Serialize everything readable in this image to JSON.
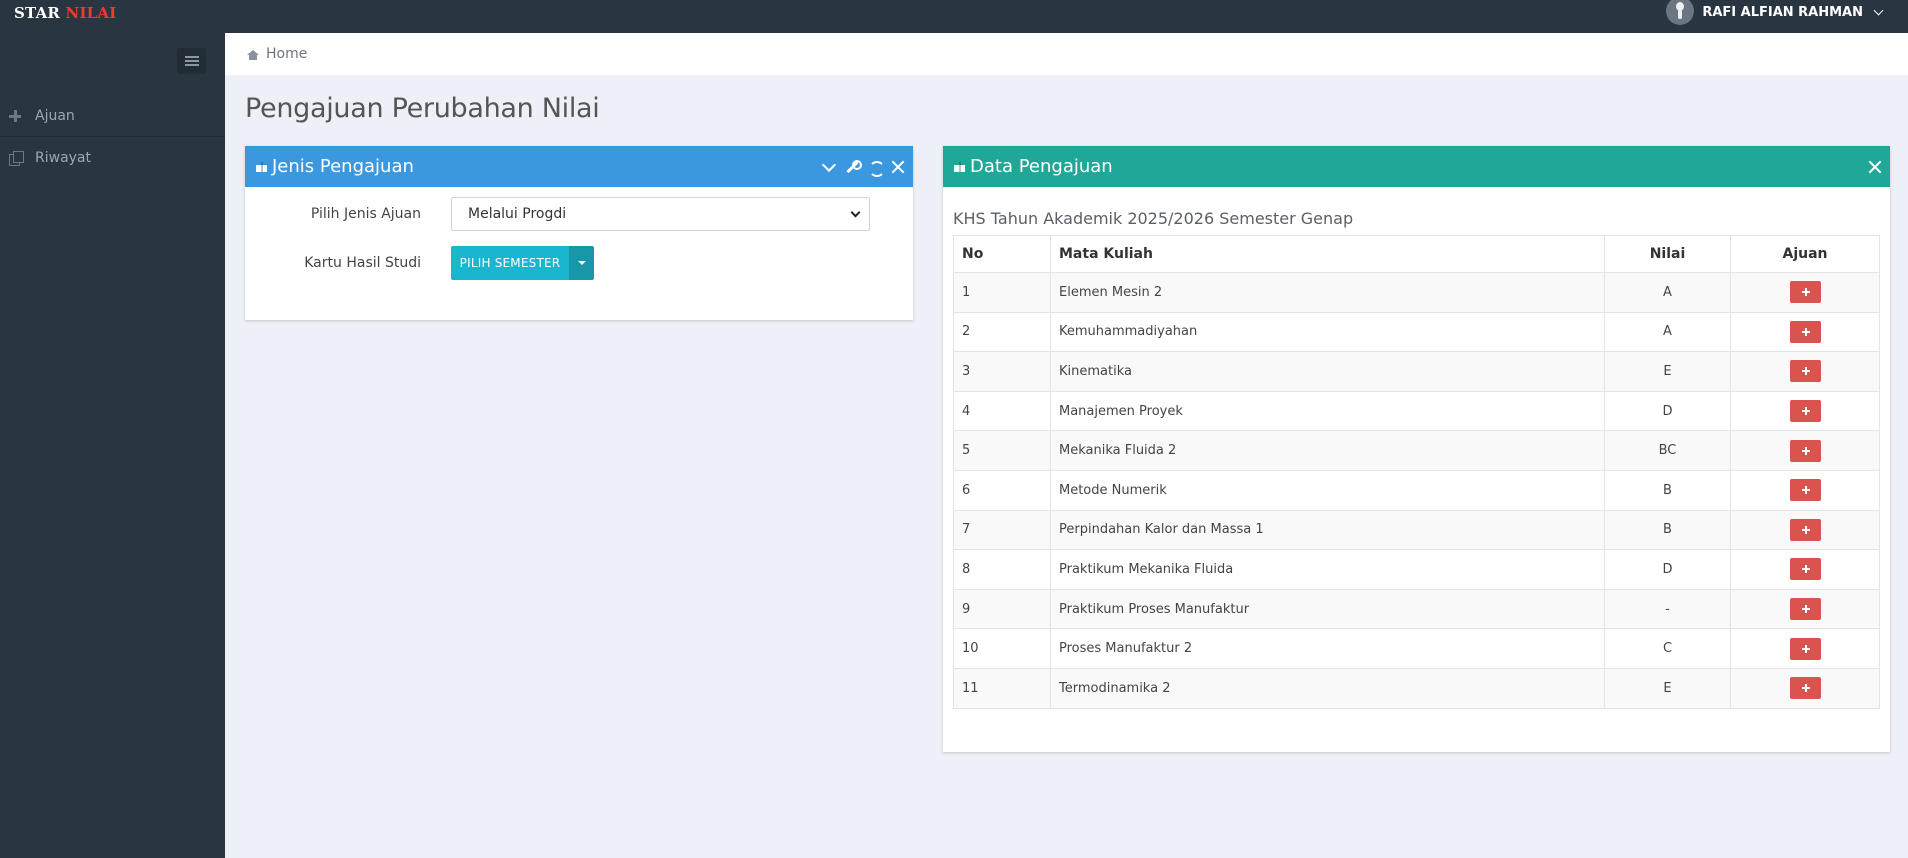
{
  "brand": {
    "part1": "STAR",
    "part2": "NILAI"
  },
  "user": {
    "name": "RAFI ALFIAN RAHMAN"
  },
  "sidebar": {
    "items": [
      {
        "label": "Ajuan",
        "icon": "plus-icon"
      },
      {
        "label": "Riwayat",
        "icon": "copy-icon"
      }
    ]
  },
  "breadcrumb": {
    "home": "Home"
  },
  "page": {
    "title": "Pengajuan Perubahan Nilai"
  },
  "jenis_panel": {
    "title": "Jenis Pengajuan",
    "color": "#3b98df",
    "label_jenis": "Pilih Jenis Ajuan",
    "select_value": "Melalui Progdi",
    "label_khs": "Kartu Hasil Studi",
    "semester_button": "PILIH SEMESTER"
  },
  "data_panel": {
    "title": "Data Pengajuan",
    "color": "#21a797",
    "subtitle": "KHS Tahun Akademik 2025/2026 Semester Genap",
    "columns": [
      "No",
      "Mata Kuliah",
      "Nilai",
      "Ajuan"
    ],
    "rows": [
      {
        "no": "1",
        "mk": "Elemen Mesin 2",
        "nilai": "A"
      },
      {
        "no": "2",
        "mk": "Kemuhammadiyahan",
        "nilai": "A"
      },
      {
        "no": "3",
        "mk": "Kinematika",
        "nilai": "E"
      },
      {
        "no": "4",
        "mk": "Manajemen Proyek",
        "nilai": "D"
      },
      {
        "no": "5",
        "mk": "Mekanika Fluida 2",
        "nilai": "BC"
      },
      {
        "no": "6",
        "mk": "Metode Numerik",
        "nilai": "B"
      },
      {
        "no": "7",
        "mk": "Perpindahan Kalor dan Massa 1",
        "nilai": "B"
      },
      {
        "no": "8",
        "mk": "Praktikum Mekanika Fluida",
        "nilai": "D"
      },
      {
        "no": "9",
        "mk": "Praktikum Proses Manufaktur",
        "nilai": "-"
      },
      {
        "no": "10",
        "mk": "Proses Manufaktur 2",
        "nilai": "C"
      },
      {
        "no": "11",
        "mk": "Termodinamika 2",
        "nilai": "E"
      }
    ]
  }
}
